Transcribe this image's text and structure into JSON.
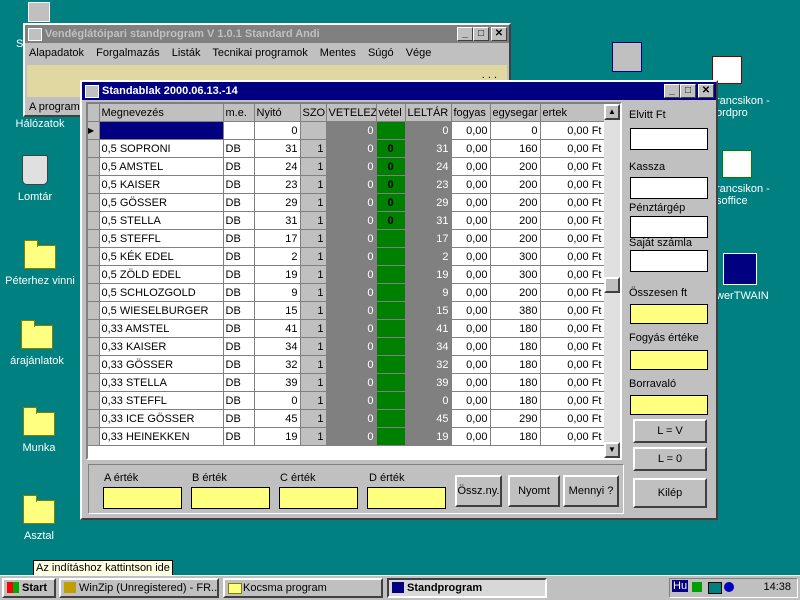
{
  "desktop": {
    "icons": [
      {
        "label": "Hálózatok"
      },
      {
        "label": "Lomtár"
      },
      {
        "label": "Péterhez vinni"
      },
      {
        "label": "árajánlatok"
      },
      {
        "label": "Munka"
      },
      {
        "label": "Asztal"
      },
      {
        "label": "rancsikon - ordpro"
      },
      {
        "label": "rancsikon - soffice"
      },
      {
        "label": "werTWAIN"
      }
    ],
    "top_icon_label": "S"
  },
  "main_window": {
    "title": "Vendéglátóipari standprogram V 1.0.1 Standard Andi",
    "menu": [
      "Alapadatok",
      "Forgalmazás",
      "Listák",
      "Tecnikai programok",
      "Mentes",
      "Súgó",
      "Vége"
    ],
    "status_text": "A program",
    "dots": ". . ."
  },
  "stand_window": {
    "title": "Standablak 2000.06.13.-14",
    "columns": [
      "Megnevezés",
      "m.e.",
      "Nyitó",
      "SZO",
      "VETELEZ",
      "vétel",
      "LELTÁR",
      "fogyas",
      "egysegar",
      "ertek"
    ],
    "rows": [
      [
        "",
        "",
        "0",
        "",
        "0",
        "",
        "0",
        "0,00",
        "0",
        "0,00 Ft"
      ],
      [
        "0,5 SOPRONI",
        "DB",
        "31",
        "1",
        "0",
        "0",
        "31",
        "0,00",
        "160",
        "0,00 Ft"
      ],
      [
        "0,5  AMSTEL",
        "DB",
        "24",
        "1",
        "0",
        "0",
        "24",
        "0,00",
        "200",
        "0,00 Ft"
      ],
      [
        "0,5  KAISER",
        "DB",
        "23",
        "1",
        "0",
        "0",
        "23",
        "0,00",
        "200",
        "0,00 Ft"
      ],
      [
        "0,5 GÖSSER",
        "DB",
        "29",
        "1",
        "0",
        "0",
        "29",
        "0,00",
        "200",
        "0,00 Ft"
      ],
      [
        "0,5 STELLA",
        "DB",
        "31",
        "1",
        "0",
        "0",
        "31",
        "0,00",
        "200",
        "0,00 Ft"
      ],
      [
        "0,5 STEFFL",
        "DB",
        "17",
        "1",
        "0",
        "",
        "17",
        "0,00",
        "200",
        "0,00 Ft"
      ],
      [
        "0,5 KÉK EDEL",
        "DB",
        "2",
        "1",
        "0",
        "",
        "2",
        "0,00",
        "300",
        "0,00 Ft"
      ],
      [
        "0,5 ZÖLD EDEL",
        "DB",
        "19",
        "1",
        "0",
        "",
        "19",
        "0,00",
        "300",
        "0,00 Ft"
      ],
      [
        "0,5 SCHLOZGOLD",
        "DB",
        "9",
        "1",
        "0",
        "",
        "9",
        "0,00",
        "200",
        "0,00 Ft"
      ],
      [
        "0,5 WIESELBURGER",
        "DB",
        "15",
        "1",
        "0",
        "",
        "15",
        "0,00",
        "380",
        "0,00 Ft"
      ],
      [
        "0,33 AMSTEL",
        "DB",
        "41",
        "1",
        "0",
        "",
        "41",
        "0,00",
        "180",
        "0,00 Ft"
      ],
      [
        "0,33 KAISER",
        "DB",
        "34",
        "1",
        "0",
        "",
        "34",
        "0,00",
        "180",
        "0,00 Ft"
      ],
      [
        "0,33 GÖSSER",
        "DB",
        "32",
        "1",
        "0",
        "",
        "32",
        "0,00",
        "180",
        "0,00 Ft"
      ],
      [
        "0,33 STELLA",
        "DB",
        "39",
        "1",
        "0",
        "",
        "39",
        "0,00",
        "180",
        "0,00 Ft"
      ],
      [
        "0,33 STEFFL",
        "DB",
        "0",
        "1",
        "0",
        "",
        "0",
        "0,00",
        "180",
        "0,00 Ft"
      ],
      [
        "0,33 ICE GÖSSER",
        "DB",
        "45",
        "1",
        "0",
        "",
        "45",
        "0,00",
        "290",
        "0,00 Ft"
      ],
      [
        "0,33 HEINEKKEN",
        "DB",
        "19",
        "1",
        "0",
        "",
        "19",
        "0,00",
        "180",
        "0,00 Ft"
      ]
    ],
    "right_panel": {
      "elvitt": "Elvitt Ft",
      "kassza": "Kassza",
      "penztargep": "Pénztárgép",
      "sajat": "Saját számla",
      "osszesen": "Összesen ft",
      "fogyas": "Fogyás értéke",
      "borravalo": "Borravaló",
      "btn_lv": "L = V",
      "btn_l0": "L = 0",
      "btn_kilep": "Kilép"
    },
    "bottom": {
      "a": "A érték",
      "b": "B érték",
      "c": "C érték",
      "d": "D érték",
      "btn_ossz": "Össz.ny.",
      "btn_nyomt": "Nyomt",
      "btn_mennyi": "Mennyi ?"
    }
  },
  "tooltip": "Az indításhoz kattintson ide",
  "taskbar": {
    "start": "Start",
    "tasks": [
      "WinZip (Unregistered) - FR...",
      "Kocsma program",
      "Standprogram"
    ],
    "lang": "Hu",
    "clock": "14:38"
  }
}
